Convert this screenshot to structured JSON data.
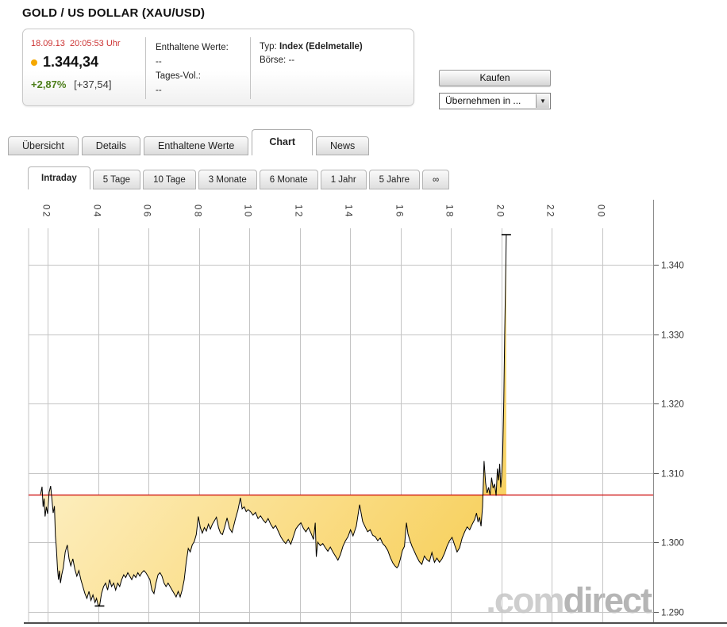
{
  "header": {
    "title": "GOLD / US DOLLAR (XAU/USD)"
  },
  "quote_box": {
    "date": "18.09.13",
    "time": "20:05:53 Uhr",
    "price": "1.344,34",
    "change_percent": "+2,87%",
    "change_abs": "[+37,54]",
    "col2": {
      "label1": "Enthaltene Werte:",
      "value1": "--",
      "label2": "Tages-Vol.:",
      "value2": "--"
    },
    "col3": {
      "typ_label": "Typ:",
      "typ_value": "Index (Edelmetalle)",
      "boerse_label": "Börse:",
      "boerse_value": "--"
    }
  },
  "actions": {
    "buy_label": "Kaufen",
    "assume_label": "Übernehmen in ..."
  },
  "icons": {
    "dropdown_arrow": "▼"
  },
  "tabs": [
    {
      "label": "Übersicht",
      "active": false
    },
    {
      "label": "Details",
      "active": false
    },
    {
      "label": "Enthaltene Werte",
      "active": false
    },
    {
      "label": "Chart",
      "active": true
    },
    {
      "label": "News",
      "active": false
    }
  ],
  "subtabs": [
    {
      "label": "Intraday",
      "active": true
    },
    {
      "label": "5 Tage",
      "active": false
    },
    {
      "label": "10 Tage",
      "active": false
    },
    {
      "label": "3 Monate",
      "active": false
    },
    {
      "label": "6 Monate",
      "active": false
    },
    {
      "label": "1 Jahr",
      "active": false
    },
    {
      "label": "5 Jahre",
      "active": false
    },
    {
      "label": "∞",
      "active": false
    }
  ],
  "watermark": {
    "part1": ".com",
    "part2": "direct"
  },
  "colors": {
    "date_red": "#cc3333",
    "dot_yellow": "#f5a800",
    "change_green": "#4e7f1c",
    "wm_light": "#cecece",
    "wm_dark": "#b5b5b5"
  },
  "chart_data": {
    "type": "line",
    "title": "XAU/USD Intraday 18.09.2013",
    "x_axis": {
      "unit": "hour",
      "tick_labels": [
        "02",
        "04",
        "06",
        "08",
        "10",
        "12",
        "14",
        "16",
        "18",
        "20",
        "22",
        "00"
      ],
      "tick_hours": [
        2,
        4,
        6,
        8,
        10,
        12,
        14,
        16,
        18,
        20,
        22,
        24
      ]
    },
    "y_axis": {
      "tick_labels": [
        "1.340",
        "1.330",
        "1.320",
        "1.310",
        "1.300",
        "1.290"
      ],
      "tick_values": [
        1340,
        1330,
        1320,
        1310,
        1300,
        1290
      ],
      "ylim": [
        1288,
        1346
      ]
    },
    "reference_line": {
      "name": "previous-close",
      "value": 1306.8,
      "color": "#cc0000"
    },
    "line_color": "#000000",
    "grid_color": "#c4c4c4",
    "axis_color": "#8a8a8a",
    "fill_colors": [
      "#fffbea",
      "#f7cc4f"
    ],
    "low_marker": [
      4.06,
      1290.8
    ],
    "high_marker": [
      20.2,
      1344.34
    ],
    "series": [
      {
        "name": "XAU/USD",
        "points": [
          [
            1.72,
            1306.9
          ],
          [
            1.78,
            1308.0
          ],
          [
            1.82,
            1305.1
          ],
          [
            1.86,
            1306.3
          ],
          [
            1.9,
            1303.7
          ],
          [
            1.95,
            1305.1
          ],
          [
            2.0,
            1304.1
          ],
          [
            2.06,
            1307.2
          ],
          [
            2.12,
            1308.1
          ],
          [
            2.17,
            1306.2
          ],
          [
            2.22,
            1304.2
          ],
          [
            2.27,
            1305.2
          ],
          [
            2.31,
            1300.9
          ],
          [
            2.35,
            1299.0
          ],
          [
            2.39,
            1296.3
          ],
          [
            2.43,
            1294.6
          ],
          [
            2.47,
            1295.9
          ],
          [
            2.51,
            1294.1
          ],
          [
            2.56,
            1295.3
          ],
          [
            2.62,
            1296.3
          ],
          [
            2.7,
            1298.6
          ],
          [
            2.78,
            1299.6
          ],
          [
            2.85,
            1297.6
          ],
          [
            2.92,
            1296.6
          ],
          [
            3.0,
            1297.6
          ],
          [
            3.08,
            1296.1
          ],
          [
            3.16,
            1295.1
          ],
          [
            3.24,
            1295.9
          ],
          [
            3.32,
            1294.6
          ],
          [
            3.4,
            1293.6
          ],
          [
            3.48,
            1292.6
          ],
          [
            3.56,
            1291.9
          ],
          [
            3.64,
            1292.9
          ],
          [
            3.72,
            1291.6
          ],
          [
            3.8,
            1292.4
          ],
          [
            3.88,
            1291.3
          ],
          [
            3.94,
            1291.9
          ],
          [
            4.0,
            1291.0
          ],
          [
            4.06,
            1290.8
          ],
          [
            4.14,
            1292.6
          ],
          [
            4.22,
            1293.6
          ],
          [
            4.3,
            1294.1
          ],
          [
            4.38,
            1293.1
          ],
          [
            4.46,
            1294.6
          ],
          [
            4.54,
            1293.6
          ],
          [
            4.62,
            1294.1
          ],
          [
            4.7,
            1293.1
          ],
          [
            4.78,
            1294.1
          ],
          [
            4.86,
            1293.6
          ],
          [
            4.94,
            1294.6
          ],
          [
            5.02,
            1295.3
          ],
          [
            5.1,
            1294.9
          ],
          [
            5.18,
            1295.6
          ],
          [
            5.26,
            1295.1
          ],
          [
            5.34,
            1294.6
          ],
          [
            5.42,
            1295.3
          ],
          [
            5.5,
            1294.9
          ],
          [
            5.58,
            1295.6
          ],
          [
            5.66,
            1295.1
          ],
          [
            5.74,
            1295.6
          ],
          [
            5.82,
            1295.9
          ],
          [
            5.9,
            1295.6
          ],
          [
            5.98,
            1295.1
          ],
          [
            6.06,
            1294.6
          ],
          [
            6.14,
            1293.1
          ],
          [
            6.22,
            1292.6
          ],
          [
            6.3,
            1294.1
          ],
          [
            6.38,
            1295.3
          ],
          [
            6.46,
            1295.6
          ],
          [
            6.54,
            1295.1
          ],
          [
            6.62,
            1294.1
          ],
          [
            6.7,
            1293.6
          ],
          [
            6.78,
            1294.1
          ],
          [
            6.86,
            1293.6
          ],
          [
            6.94,
            1293.1
          ],
          [
            7.02,
            1292.6
          ],
          [
            7.1,
            1292.1
          ],
          [
            7.18,
            1292.9
          ],
          [
            7.26,
            1292.1
          ],
          [
            7.34,
            1293.1
          ],
          [
            7.42,
            1294.6
          ],
          [
            7.5,
            1297.1
          ],
          [
            7.58,
            1299.1
          ],
          [
            7.66,
            1298.6
          ],
          [
            7.74,
            1299.6
          ],
          [
            7.82,
            1300.1
          ],
          [
            7.9,
            1301.1
          ],
          [
            7.98,
            1303.7
          ],
          [
            8.06,
            1302.1
          ],
          [
            8.14,
            1301.3
          ],
          [
            8.22,
            1302.1
          ],
          [
            8.3,
            1301.6
          ],
          [
            8.38,
            1302.6
          ],
          [
            8.46,
            1301.9
          ],
          [
            8.54,
            1302.6
          ],
          [
            8.62,
            1303.1
          ],
          [
            8.7,
            1303.6
          ],
          [
            8.78,
            1302.1
          ],
          [
            8.86,
            1301.3
          ],
          [
            8.94,
            1301.1
          ],
          [
            9.02,
            1302.1
          ],
          [
            9.12,
            1303.5
          ],
          [
            9.22,
            1302.0
          ],
          [
            9.32,
            1301.4
          ],
          [
            9.45,
            1303.3
          ],
          [
            9.55,
            1304.6
          ],
          [
            9.65,
            1306.4
          ],
          [
            9.72,
            1304.8
          ],
          [
            9.8,
            1305.1
          ],
          [
            9.88,
            1304.4
          ],
          [
            9.96,
            1304.7
          ],
          [
            10.05,
            1304.4
          ],
          [
            10.15,
            1303.9
          ],
          [
            10.25,
            1304.3
          ],
          [
            10.35,
            1303.4
          ],
          [
            10.45,
            1303.8
          ],
          [
            10.55,
            1303.2
          ],
          [
            10.65,
            1302.8
          ],
          [
            10.75,
            1303.4
          ],
          [
            10.85,
            1302.6
          ],
          [
            10.95,
            1302.0
          ],
          [
            11.05,
            1302.4
          ],
          [
            11.15,
            1301.6
          ],
          [
            11.25,
            1300.8
          ],
          [
            11.35,
            1300.2
          ],
          [
            11.45,
            1299.8
          ],
          [
            11.55,
            1300.4
          ],
          [
            11.65,
            1299.7
          ],
          [
            11.75,
            1300.8
          ],
          [
            11.85,
            1301.9
          ],
          [
            11.95,
            1302.4
          ],
          [
            12.05,
            1302.8
          ],
          [
            12.15,
            1302.0
          ],
          [
            12.25,
            1301.5
          ],
          [
            12.35,
            1302.1
          ],
          [
            12.45,
            1301.3
          ],
          [
            12.55,
            1300.4
          ],
          [
            12.62,
            1302.8
          ],
          [
            12.66,
            1297.9
          ],
          [
            12.72,
            1300.0
          ],
          [
            12.82,
            1299.5
          ],
          [
            12.92,
            1299.8
          ],
          [
            13.02,
            1299.2
          ],
          [
            13.12,
            1298.7
          ],
          [
            13.22,
            1299.3
          ],
          [
            13.32,
            1298.6
          ],
          [
            13.42,
            1298.0
          ],
          [
            13.52,
            1297.4
          ],
          [
            13.62,
            1298.2
          ],
          [
            13.72,
            1299.4
          ],
          [
            13.82,
            1300.2
          ],
          [
            13.92,
            1300.8
          ],
          [
            14.02,
            1301.8
          ],
          [
            14.12,
            1300.9
          ],
          [
            14.25,
            1302.3
          ],
          [
            14.38,
            1305.4
          ],
          [
            14.5,
            1303.0
          ],
          [
            14.6,
            1302.2
          ],
          [
            14.7,
            1301.5
          ],
          [
            14.8,
            1301.8
          ],
          [
            14.9,
            1301.0
          ],
          [
            15.0,
            1300.8
          ],
          [
            15.1,
            1300.2
          ],
          [
            15.2,
            1300.6
          ],
          [
            15.3,
            1299.8
          ],
          [
            15.4,
            1299.4
          ],
          [
            15.5,
            1298.8
          ],
          [
            15.6,
            1297.8
          ],
          [
            15.7,
            1297.0
          ],
          [
            15.78,
            1296.6
          ],
          [
            15.86,
            1296.3
          ],
          [
            15.92,
            1296.6
          ],
          [
            16.0,
            1297.6
          ],
          [
            16.08,
            1298.8
          ],
          [
            16.16,
            1299.4
          ],
          [
            16.24,
            1302.8
          ],
          [
            16.3,
            1301.2
          ],
          [
            16.38,
            1300.2
          ],
          [
            16.46,
            1299.4
          ],
          [
            16.55,
            1298.7
          ],
          [
            16.65,
            1297.9
          ],
          [
            16.75,
            1297.2
          ],
          [
            16.85,
            1296.8
          ],
          [
            16.95,
            1298.0
          ],
          [
            17.05,
            1297.5
          ],
          [
            17.15,
            1297.2
          ],
          [
            17.25,
            1298.5
          ],
          [
            17.35,
            1297.1
          ],
          [
            17.45,
            1297.7
          ],
          [
            17.55,
            1297.1
          ],
          [
            17.65,
            1297.6
          ],
          [
            17.75,
            1298.4
          ],
          [
            17.85,
            1299.4
          ],
          [
            17.95,
            1300.2
          ],
          [
            18.05,
            1300.7
          ],
          [
            18.15,
            1299.6
          ],
          [
            18.25,
            1298.6
          ],
          [
            18.35,
            1299.2
          ],
          [
            18.45,
            1300.6
          ],
          [
            18.55,
            1301.5
          ],
          [
            18.65,
            1302.2
          ],
          [
            18.75,
            1301.8
          ],
          [
            18.85,
            1302.6
          ],
          [
            18.95,
            1303.3
          ],
          [
            19.02,
            1304.2
          ],
          [
            19.08,
            1302.9
          ],
          [
            19.14,
            1303.6
          ],
          [
            19.2,
            1302.3
          ],
          [
            19.26,
            1305.1
          ],
          [
            19.32,
            1311.7
          ],
          [
            19.38,
            1308.6
          ],
          [
            19.44,
            1307.1
          ],
          [
            19.5,
            1307.9
          ],
          [
            19.56,
            1306.8
          ],
          [
            19.62,
            1309.3
          ],
          [
            19.68,
            1307.8
          ],
          [
            19.74,
            1308.4
          ],
          [
            19.8,
            1306.7
          ],
          [
            19.85,
            1310.6
          ],
          [
            19.9,
            1308.9
          ],
          [
            19.94,
            1311.3
          ],
          [
            19.98,
            1307.9
          ],
          [
            20.02,
            1309.5
          ],
          [
            20.06,
            1313.0
          ],
          [
            20.1,
            1320.0
          ],
          [
            20.14,
            1330.0
          ],
          [
            20.17,
            1337.0
          ],
          [
            20.2,
            1344.34
          ]
        ]
      }
    ]
  }
}
